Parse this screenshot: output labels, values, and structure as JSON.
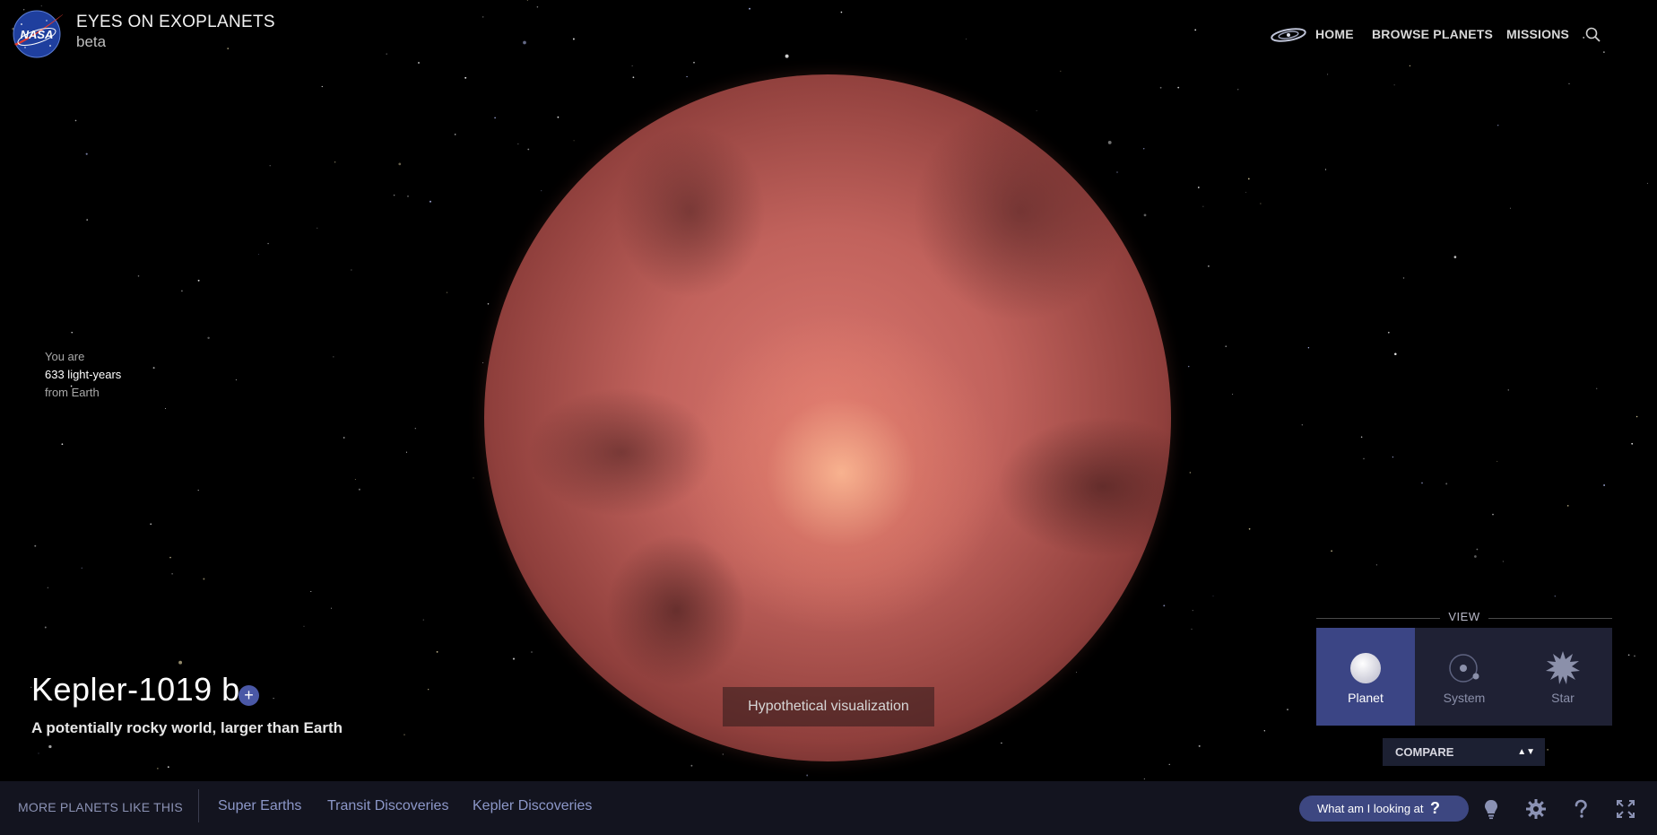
{
  "header": {
    "title": "EYES ON EXOPLANETS",
    "subtitle": "beta",
    "logo_text": "NASA",
    "nav": [
      "HOME",
      "BROWSE PLANETS",
      "MISSIONS"
    ]
  },
  "distance": {
    "line1": "You are",
    "line2": "633 light-years",
    "line3": "from Earth"
  },
  "planet": {
    "name": "Kepler-1019 b",
    "add_symbol": "+",
    "tagline": "A potentially rocky world, larger than Earth",
    "visual_note": "Hypothetical visualization"
  },
  "view_panel": {
    "label": "VIEW",
    "buttons": [
      "Planet",
      "System",
      "Star"
    ],
    "active": "Planet",
    "compare_label": "COMPARE",
    "compare_arrows": "▲▼"
  },
  "footer": {
    "more_label": "MORE PLANETS LIKE THIS",
    "links": [
      "Super Earths",
      "Transit Discoveries",
      "Kepler Discoveries"
    ],
    "what_label": "What am I looking at",
    "what_symbol": "?"
  },
  "icons": [
    "nasa-logo",
    "galaxy-icon",
    "search-icon",
    "plus-icon",
    "planet-icon",
    "system-icon",
    "star-icon",
    "lightbulb-icon",
    "gear-icon",
    "help-icon",
    "fullscreen-icon"
  ],
  "colors": {
    "accent": "#3b4585",
    "footer_bg": "#13141f",
    "link": "#8c97c8",
    "planet": "#c1625c"
  }
}
